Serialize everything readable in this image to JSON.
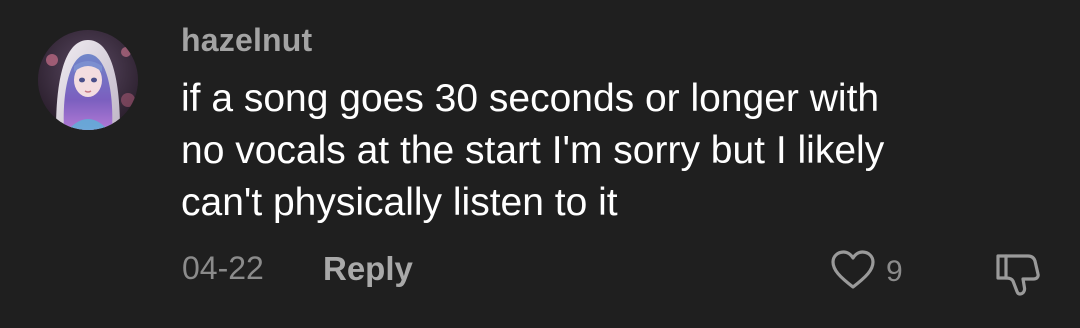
{
  "comment": {
    "username": "hazelnut",
    "text_lines": [
      "if a song goes 30 seconds or longer with",
      "no vocals at the start I'm sorry but I likely",
      "can't physically listen to it"
    ],
    "date": "04-22",
    "reply_label": "Reply",
    "like_count": "9",
    "avatar_icon": "anime-girl-avatar",
    "like_icon": "heart-outline-icon",
    "dislike_icon": "thumbs-down-outline-icon"
  },
  "colors": {
    "background": "#1f1f1f",
    "username": "#a3a3a3",
    "text": "#ffffff",
    "meta": "#8b8b8b"
  }
}
